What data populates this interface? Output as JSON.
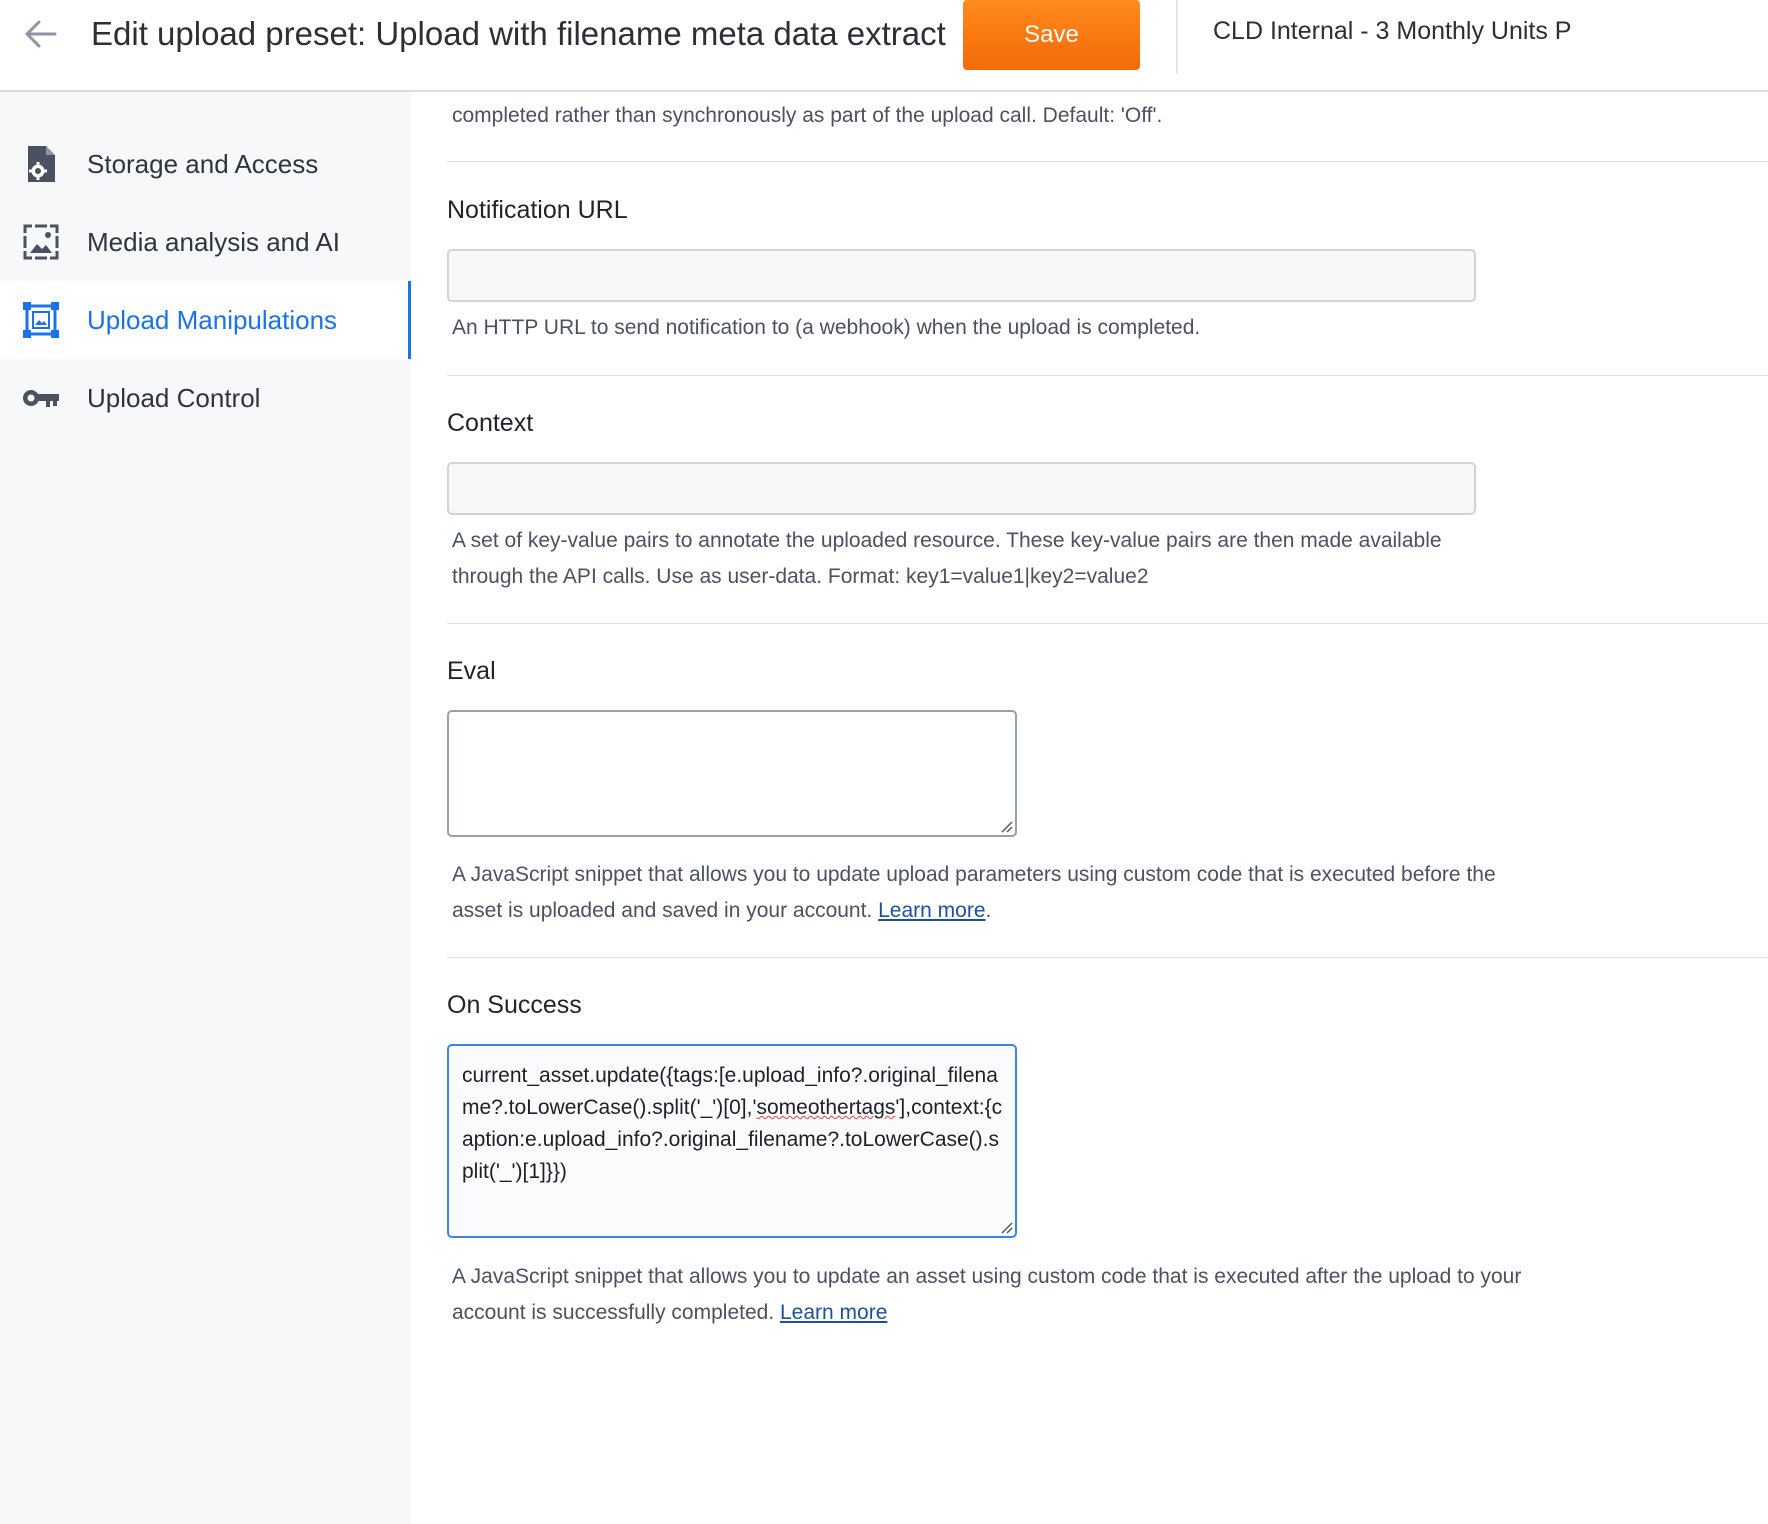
{
  "header": {
    "title": "Edit upload preset: Upload with filename meta data extract",
    "save_label": "Save",
    "account": "CLD Internal - 3 Monthly Units P"
  },
  "sidebar": {
    "items": [
      {
        "label": "Storage and Access",
        "icon": "file-gear-icon",
        "active": false
      },
      {
        "label": "Media analysis and AI",
        "icon": "image-frame-icon",
        "active": false
      },
      {
        "label": "Upload Manipulations",
        "icon": "crop-frame-icon",
        "active": true
      },
      {
        "label": "Upload Control",
        "icon": "key-icon",
        "active": false
      }
    ]
  },
  "main": {
    "truncated_desc": "completed rather than synchronously as part of the upload call. Default: 'Off'.",
    "notification_url": {
      "label": "Notification URL",
      "value": "",
      "desc": "An HTTP URL to send notification to (a webhook) when the upload is completed."
    },
    "context": {
      "label": "Context",
      "value": "",
      "desc": "A set of key-value pairs to annotate the uploaded resource. These key-value pairs are then made available through the API calls. Use as user-data. Format: key1=value1|key2=value2"
    },
    "eval": {
      "label": "Eval",
      "value": "",
      "desc": "A JavaScript snippet that allows you to update upload parameters using custom code that is executed before the asset is uploaded and saved in your account.",
      "link": "Learn more",
      "suffix": "."
    },
    "on_success": {
      "label": "On Success",
      "code_part1": "current_asset.update({tags:[e.upload_info?.original_filename?.toLowerCase().split('_')[0],'",
      "code_spell": "someothertags",
      "code_part2": "'],context:{caption:e.upload_info?.original_filename?.toLowerCase().split('_')[1]}})",
      "desc": "A JavaScript snippet that allows you to update an asset using custom code that is executed after the upload to your account is successfully completed.",
      "link": "Learn more"
    }
  },
  "colors": {
    "accent": "#1a73e8",
    "save_button": "#f97a10",
    "link": "#1d4f9c"
  }
}
